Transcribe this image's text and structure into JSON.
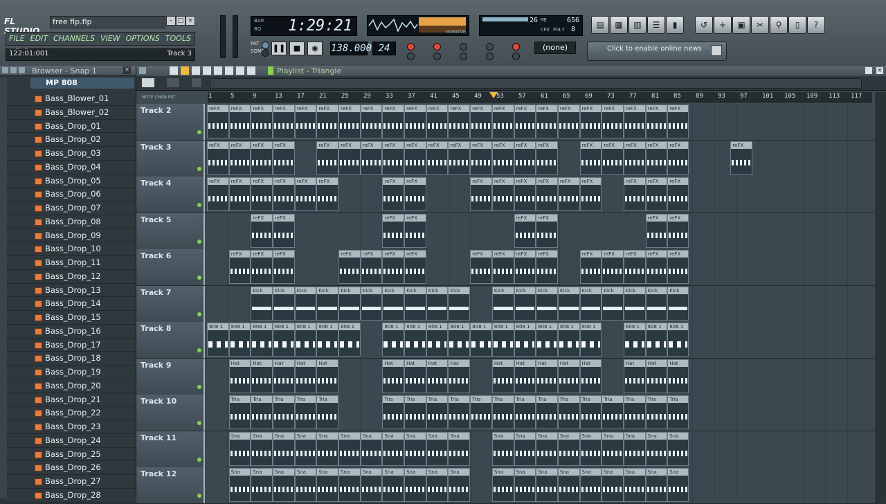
{
  "app": {
    "logo_text": "FL STUDIO",
    "file_name": "free flp.flp",
    "menu": [
      "FILE",
      "EDIT",
      "CHANNELS",
      "VIEW",
      "OPTIONS",
      "TOOLS",
      "HELP"
    ],
    "hint_left": "122:01:001",
    "hint_right": "Track 3"
  },
  "transport": {
    "time_label_top": "BAR",
    "time_label_bottom": "BQ",
    "time": "1:29:21",
    "tempo": "138.000",
    "pattern": "24",
    "snap": "(none)",
    "pat_label": "PAT",
    "song_label": "SONG"
  },
  "cpu": {
    "mem_value": "26",
    "mem_label": "MB",
    "cpu_value": "656",
    "cpu_label": "CPU",
    "poly_label": "POLY",
    "poly_value": "8"
  },
  "monitor_label": "MONITOR",
  "news_text": "Click to enable online news",
  "browser": {
    "title": "Browser - Snap 1",
    "folder": "MP 808",
    "items": [
      "Bass_Blower_01",
      "Bass_Blower_02",
      "Bass_Drop_01",
      "Bass_Drop_02",
      "Bass_Drop_03",
      "Bass_Drop_04",
      "Bass_Drop_05",
      "Bass_Drop_06",
      "Bass_Drop_07",
      "Bass_Drop_08",
      "Bass_Drop_09",
      "Bass_Drop_10",
      "Bass_Drop_11",
      "Bass_Drop_12",
      "Bass_Drop_13",
      "Bass_Drop_14",
      "Bass_Drop_15",
      "Bass_Drop_16",
      "Bass_Drop_17",
      "Bass_Drop_18",
      "Bass_Drop_19",
      "Bass_Drop_20",
      "Bass_Drop_21",
      "Bass_Drop_22",
      "Bass_Drop_23",
      "Bass_Drop_24",
      "Bass_Drop_25",
      "Bass_Drop_26",
      "Bass_Drop_27",
      "Bass_Drop_28"
    ]
  },
  "playlist": {
    "title": "Playlist - Triangle",
    "ruler_header": "NOTE CHAN PAT",
    "ruler": [
      "1",
      "5",
      "9",
      "13",
      "17",
      "21",
      "25",
      "29",
      "33",
      "37",
      "41",
      "45",
      "49",
      "53",
      "57",
      "61",
      "65",
      "69",
      "73",
      "77",
      "81",
      "85",
      "89",
      "93",
      "97",
      "101",
      "105",
      "109",
      "113",
      "117"
    ],
    "tracks": [
      {
        "name": "Track 2",
        "clip": "reFX",
        "style": "dense",
        "ranges": [
          [
            0,
            31
          ],
          [
            32,
            63
          ],
          [
            64,
            95
          ],
          [
            96,
            127
          ],
          [
            128,
            159
          ],
          [
            160,
            191
          ],
          [
            192,
            223
          ],
          [
            224,
            255
          ],
          [
            256,
            287
          ],
          [
            288,
            319
          ],
          [
            320,
            351
          ],
          [
            352,
            383
          ],
          [
            384,
            415
          ],
          [
            416,
            447
          ],
          [
            448,
            479
          ],
          [
            480,
            511
          ],
          [
            512,
            543
          ],
          [
            544,
            575
          ],
          [
            576,
            607
          ],
          [
            608,
            639
          ],
          [
            640,
            671
          ],
          [
            672,
            702
          ]
        ]
      },
      {
        "name": "Track 3",
        "clip": "reFX",
        "style": "dense",
        "ranges": [
          [
            0,
            31
          ],
          [
            32,
            63
          ],
          [
            64,
            95
          ],
          [
            96,
            127
          ],
          [
            160,
            191
          ],
          [
            192,
            223
          ],
          [
            224,
            255
          ],
          [
            256,
            287
          ],
          [
            288,
            319
          ],
          [
            320,
            351
          ],
          [
            352,
            383
          ],
          [
            384,
            415
          ],
          [
            416,
            447
          ],
          [
            448,
            479
          ],
          [
            480,
            511
          ],
          [
            544,
            575
          ],
          [
            576,
            607
          ],
          [
            608,
            639
          ],
          [
            640,
            671
          ],
          [
            672,
            702
          ],
          [
            764,
            795
          ]
        ]
      },
      {
        "name": "Track 4",
        "clip": "reFX",
        "style": "dense",
        "ranges": [
          [
            0,
            31
          ],
          [
            32,
            63
          ],
          [
            64,
            95
          ],
          [
            96,
            127
          ],
          [
            128,
            159
          ],
          [
            160,
            191
          ],
          [
            256,
            287
          ],
          [
            288,
            319
          ],
          [
            384,
            415
          ],
          [
            416,
            447
          ],
          [
            448,
            479
          ],
          [
            480,
            511
          ],
          [
            512,
            543
          ],
          [
            544,
            575
          ],
          [
            608,
            639
          ],
          [
            640,
            671
          ],
          [
            672,
            702
          ]
        ]
      },
      {
        "name": "Track 5",
        "clip": "reFX",
        "style": "sparse",
        "ranges": [
          [
            64,
            95
          ],
          [
            96,
            127
          ],
          [
            256,
            287
          ],
          [
            288,
            319
          ],
          [
            448,
            479
          ],
          [
            480,
            511
          ],
          [
            640,
            671
          ],
          [
            672,
            702
          ]
        ]
      },
      {
        "name": "Track 6",
        "clip": "reFX",
        "style": "sparse",
        "ranges": [
          [
            32,
            63
          ],
          [
            64,
            95
          ],
          [
            96,
            127
          ],
          [
            192,
            223
          ],
          [
            224,
            255
          ],
          [
            256,
            287
          ],
          [
            288,
            319
          ],
          [
            384,
            415
          ],
          [
            416,
            447
          ],
          [
            448,
            479
          ],
          [
            480,
            511
          ],
          [
            544,
            575
          ],
          [
            576,
            607
          ],
          [
            608,
            639
          ],
          [
            640,
            671
          ],
          [
            672,
            702
          ]
        ]
      },
      {
        "name": "Track 7",
        "clip": "Kick",
        "style": "solid",
        "ranges": [
          [
            64,
            95
          ],
          [
            96,
            127
          ],
          [
            128,
            159
          ],
          [
            160,
            191
          ],
          [
            192,
            223
          ],
          [
            224,
            255
          ],
          [
            256,
            287
          ],
          [
            288,
            319
          ],
          [
            320,
            351
          ],
          [
            352,
            383
          ],
          [
            416,
            447
          ],
          [
            448,
            479
          ],
          [
            480,
            511
          ],
          [
            512,
            543
          ],
          [
            544,
            575
          ],
          [
            576,
            607
          ],
          [
            608,
            639
          ],
          [
            640,
            671
          ],
          [
            672,
            702
          ]
        ]
      },
      {
        "name": "Track 8",
        "clip": "808 1",
        "style": "checker",
        "ranges": [
          [
            0,
            31
          ],
          [
            32,
            63
          ],
          [
            64,
            95
          ],
          [
            96,
            127
          ],
          [
            128,
            159
          ],
          [
            160,
            191
          ],
          [
            192,
            223
          ],
          [
            256,
            287
          ],
          [
            288,
            319
          ],
          [
            320,
            351
          ],
          [
            352,
            383
          ],
          [
            384,
            415
          ],
          [
            416,
            447
          ],
          [
            448,
            479
          ],
          [
            480,
            511
          ],
          [
            512,
            543
          ],
          [
            544,
            575
          ],
          [
            608,
            639
          ],
          [
            640,
            671
          ],
          [
            672,
            702
          ]
        ]
      },
      {
        "name": "Track 9",
        "clip": "Hat",
        "style": "dense",
        "ranges": [
          [
            32,
            63
          ],
          [
            64,
            95
          ],
          [
            96,
            127
          ],
          [
            128,
            159
          ],
          [
            160,
            191
          ],
          [
            256,
            287
          ],
          [
            288,
            319
          ],
          [
            320,
            351
          ],
          [
            352,
            383
          ],
          [
            416,
            447
          ],
          [
            448,
            479
          ],
          [
            480,
            511
          ],
          [
            512,
            543
          ],
          [
            544,
            575
          ],
          [
            608,
            639
          ],
          [
            640,
            671
          ],
          [
            672,
            702
          ]
        ]
      },
      {
        "name": "Track 10",
        "clip": "Tria",
        "style": "sparse",
        "ranges": [
          [
            32,
            63
          ],
          [
            64,
            95
          ],
          [
            96,
            127
          ],
          [
            128,
            159
          ],
          [
            160,
            191
          ],
          [
            256,
            287
          ],
          [
            288,
            319
          ],
          [
            320,
            351
          ],
          [
            352,
            383
          ],
          [
            384,
            415
          ],
          [
            416,
            447
          ],
          [
            448,
            479
          ],
          [
            480,
            511
          ],
          [
            512,
            543
          ],
          [
            544,
            575
          ],
          [
            576,
            607
          ],
          [
            608,
            639
          ],
          [
            640,
            671
          ],
          [
            672,
            702
          ]
        ]
      },
      {
        "name": "Track 11",
        "clip": "Sna",
        "style": "sparse",
        "ranges": [
          [
            32,
            63
          ],
          [
            64,
            95
          ],
          [
            96,
            127
          ],
          [
            128,
            159
          ],
          [
            160,
            191
          ],
          [
            192,
            223
          ],
          [
            224,
            255
          ],
          [
            256,
            287
          ],
          [
            288,
            319
          ],
          [
            320,
            351
          ],
          [
            352,
            383
          ],
          [
            416,
            447
          ],
          [
            448,
            479
          ],
          [
            480,
            511
          ],
          [
            512,
            543
          ],
          [
            544,
            575
          ],
          [
            576,
            607
          ],
          [
            608,
            639
          ],
          [
            640,
            671
          ],
          [
            672,
            702
          ]
        ]
      },
      {
        "name": "Track 12",
        "clip": "Sna",
        "style": "sparse",
        "ranges": [
          [
            32,
            63
          ],
          [
            64,
            95
          ],
          [
            96,
            127
          ],
          [
            128,
            159
          ],
          [
            160,
            191
          ],
          [
            192,
            223
          ],
          [
            224,
            255
          ],
          [
            256,
            287
          ],
          [
            288,
            319
          ],
          [
            320,
            351
          ],
          [
            352,
            383
          ],
          [
            416,
            447
          ],
          [
            448,
            479
          ],
          [
            480,
            511
          ],
          [
            512,
            543
          ],
          [
            544,
            575
          ],
          [
            576,
            607
          ],
          [
            608,
            639
          ],
          [
            640,
            671
          ],
          [
            672,
            702
          ]
        ]
      }
    ]
  }
}
